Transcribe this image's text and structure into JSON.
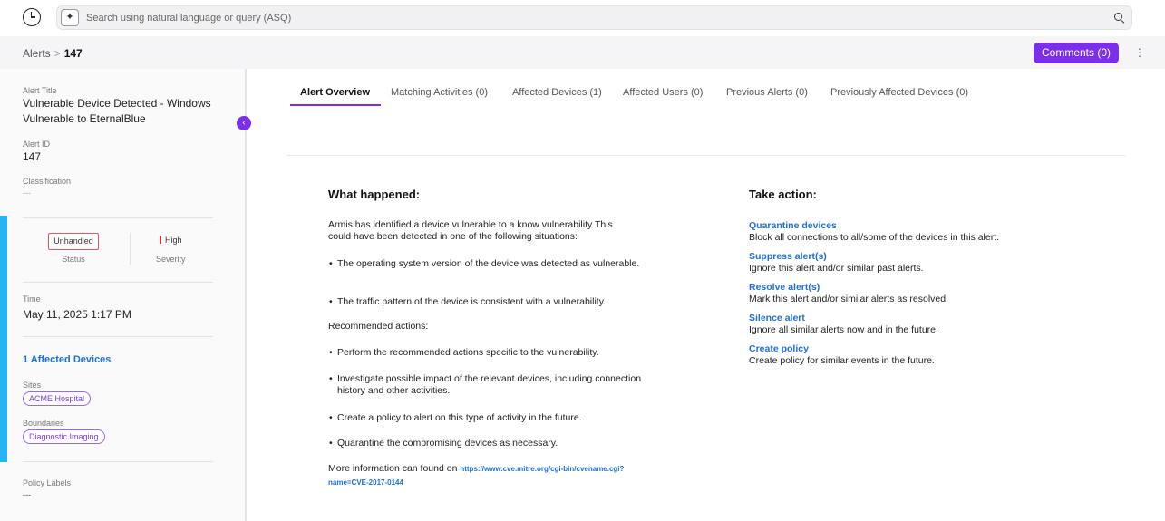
{
  "topbar": {
    "search_placeholder": "Search using natural language or query (ASQ)",
    "spark_icon": "✦"
  },
  "breadcrumb": {
    "root": "Alerts",
    "separator": ">",
    "current": "147"
  },
  "header_actions": {
    "comments_label": "Comments (0)",
    "more_icon": "⋮"
  },
  "sidebar": {
    "alert_title_label": "Alert Title",
    "alert_title_line1": "Vulnerable Device Detected - Windows",
    "alert_title_line2": "Vulnerable to EternalBlue",
    "alert_id_label": "Alert ID",
    "alert_id": "147",
    "classification_label": "Classification",
    "classification": "---",
    "status": "Unhandled",
    "status_label": "Status",
    "severity": "High",
    "severity_label": "Severity",
    "time_label": "Time",
    "time": "May 11, 2025 1:17 PM",
    "affected_devices": "1 Affected Devices",
    "sites_label": "Sites",
    "site": "ACME Hospital",
    "boundaries_label": "Boundaries",
    "boundary": "Diagnostic Imaging",
    "policy_labels_label": "Policy Labels",
    "policy_labels": "---",
    "collapse_icon": "‹"
  },
  "tabs": [
    "Alert Overview",
    "Matching Activities (0)",
    "Affected Devices (1)",
    "Affected Users (0)",
    "Previous Alerts (0)",
    "Previously Affected Devices (0)"
  ],
  "what_happened": {
    "heading": "What happened:",
    "intro_line1": "Armis has identified a device vulnerable to a know vulnerability This",
    "intro_line2": "could have been detected in one of the following situations:",
    "situations": [
      "The operating system version of the device was detected as vulnerable.",
      "The traffic pattern of the device is consistent with a vulnerability."
    ],
    "recommended_heading": "Recommended actions:",
    "recommended": [
      "Perform the recommended actions specific to the vulnerability.",
      "Investigate possible impact of the relevant devices, including connection history and other activities.",
      "Create a policy to alert on this type of activity in the future.",
      "Quarantine the compromising devices as necessary."
    ],
    "more_info_prefix": "More information can found on",
    "more_info_url_line1": "https://www.cve.mitre.org/cgi-bin/cvename.cgi?",
    "more_info_url_line2": "name=CVE-2017-0144"
  },
  "take_action": {
    "heading": "Take action:",
    "actions": [
      {
        "title": "Quarantine devices",
        "desc": "Block all connections to all/some of the devices in this alert."
      },
      {
        "title": "Suppress alert(s)",
        "desc": "Ignore this alert and/or similar past alerts."
      },
      {
        "title": "Resolve alert(s)",
        "desc": "Mark this alert and/or similar alerts as resolved."
      },
      {
        "title": "Silence alert",
        "desc": "Ignore all similar alerts now and in the future."
      },
      {
        "title": "Create policy",
        "desc": "Create policy for similar events in the future."
      }
    ]
  },
  "colors": {
    "accent_purple": "#7b2fe6",
    "link_blue": "#1f6fd6",
    "severity_red": "#d72b2b",
    "sidebar_accent": "#27b5f2"
  }
}
